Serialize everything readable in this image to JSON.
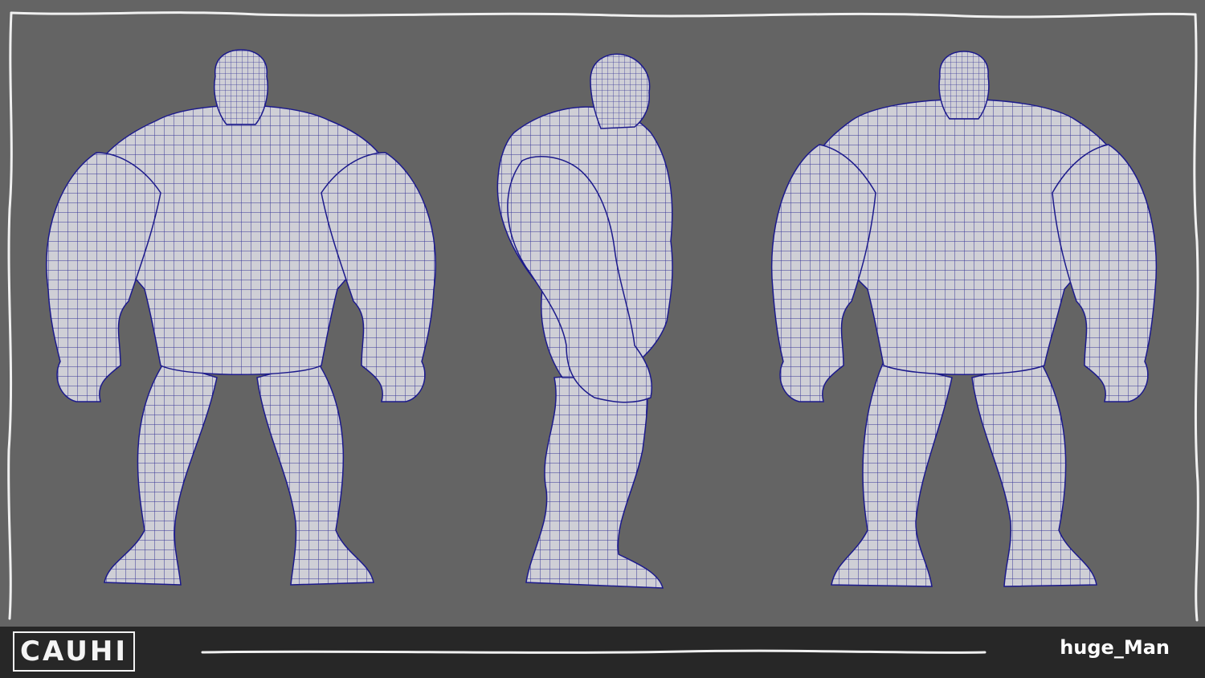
{
  "brand": {
    "logo_text": "CAUHI"
  },
  "model": {
    "name": "huge_Man"
  },
  "views": [
    {
      "id": "front"
    },
    {
      "id": "side"
    },
    {
      "id": "back"
    }
  ],
  "colors": {
    "background": "#646464",
    "mesh_fill": "#cfcfd6",
    "wire": "#1c1a8c",
    "bar": "#272727",
    "border_stroke": "#f0f0f0"
  }
}
